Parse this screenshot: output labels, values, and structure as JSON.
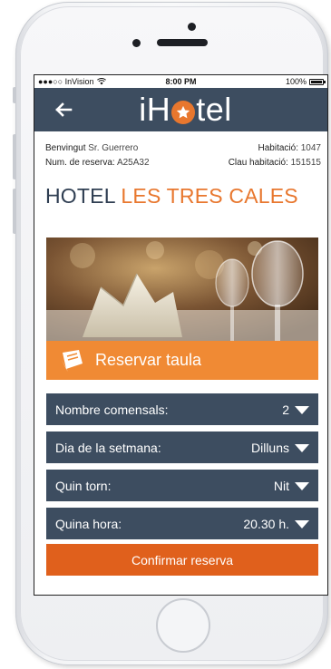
{
  "statusbar": {
    "carrier": "●●●○○ InVision",
    "time": "8:00 PM",
    "battery": "100%"
  },
  "appbar": {
    "logo_left": "iH",
    "logo_right": "tel",
    "back_icon": "back-arrow-icon"
  },
  "guest": {
    "welcome_label": "Benvingut",
    "welcome_name": "Sr. Guerrero",
    "room_label": "Habitació:",
    "room_value": "1047",
    "booking_label": "Num. de reserva:",
    "booking_value": "A25A32",
    "key_label": "Clau habitació:",
    "key_value": "151515"
  },
  "hotel": {
    "name_prefix": "HOTEL",
    "name_accent": "LES TRES CALES"
  },
  "reservation": {
    "header_label": "Reservar taula",
    "header_icon": "book-icon",
    "fields": [
      {
        "label": "Nombre comensals:",
        "value": "2"
      },
      {
        "label": "Dia de la setmana:",
        "value": "Dilluns"
      },
      {
        "label": "Quin torn:",
        "value": "Nit"
      },
      {
        "label": "Quina hora:",
        "value": "20.30 h."
      }
    ],
    "confirm_label": "Confirmar reserva"
  },
  "colors": {
    "navy": "#3d4d60",
    "orange": "#f08a34",
    "confirm": "#e0601c"
  }
}
